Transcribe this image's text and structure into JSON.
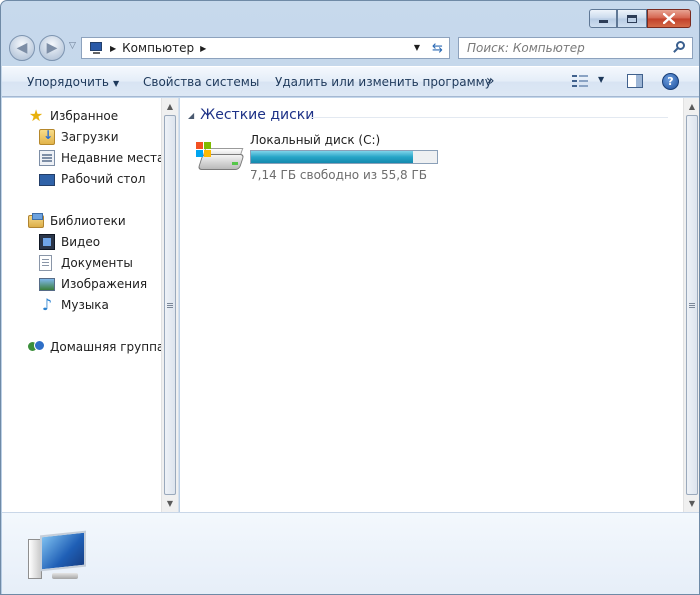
{
  "window": {
    "caption_buttons": [
      "minimize",
      "maximize",
      "close"
    ]
  },
  "address_bar": {
    "segments": [
      "Компьютер"
    ],
    "search_placeholder": "Поиск: Компьютер"
  },
  "toolbar": {
    "organize_label": "Упорядочить",
    "system_properties_label": "Свойства системы",
    "uninstall_label": "Удалить или изменить программу",
    "more_label": "»"
  },
  "sidebar": {
    "favorites": {
      "label": "Избранное",
      "items": [
        {
          "label": "Загрузки",
          "icon": "downloads-folder-icon"
        },
        {
          "label": "Недавние места",
          "icon": "recent-places-icon"
        },
        {
          "label": "Рабочий стол",
          "icon": "desktop-icon"
        }
      ]
    },
    "libraries": {
      "label": "Библиотеки",
      "items": [
        {
          "label": "Видео",
          "icon": "video-library-icon"
        },
        {
          "label": "Документы",
          "icon": "documents-library-icon"
        },
        {
          "label": "Изображения",
          "icon": "pictures-library-icon"
        },
        {
          "label": "Музыка",
          "icon": "music-library-icon"
        }
      ]
    },
    "homegroup": {
      "label": "Домашняя группа"
    }
  },
  "content": {
    "group_title": "Жесткие диски",
    "drives": [
      {
        "name": "Локальный диск (C:)",
        "free_text": "7,14 ГБ свободно из 55,8 ГБ",
        "used_fraction": 0.872
      }
    ]
  },
  "colors": {
    "group_title": "#1e3287",
    "usage_bar": "#27a5c7"
  }
}
